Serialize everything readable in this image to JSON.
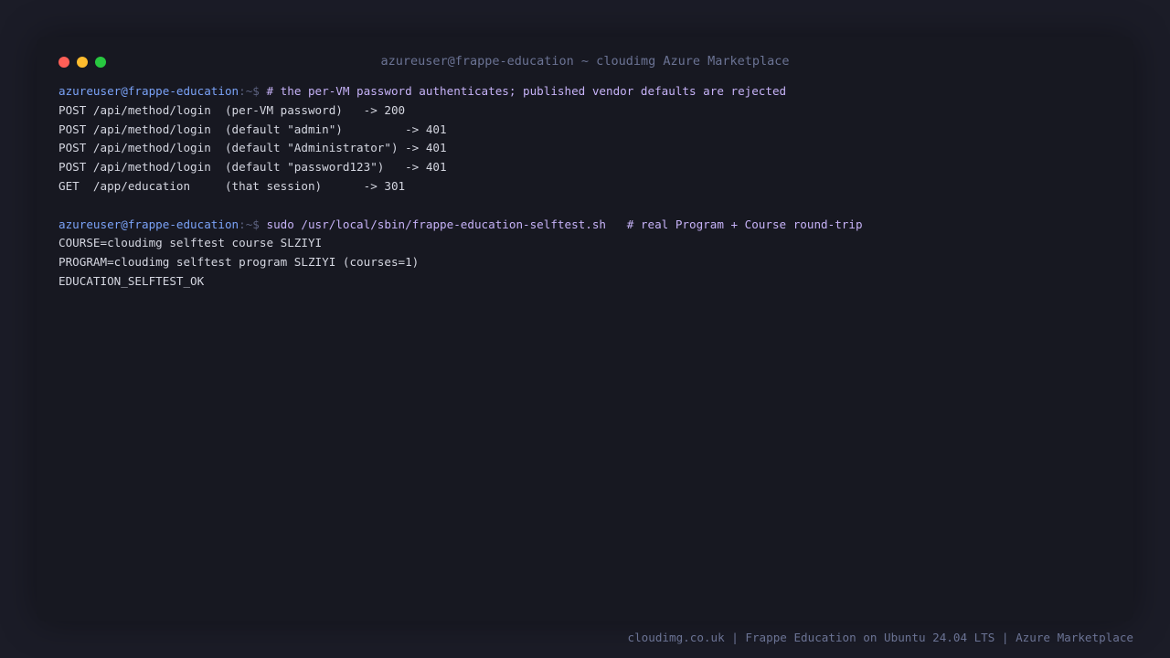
{
  "window": {
    "title": "azureuser@frappe-education ~ cloudimg Azure Marketplace"
  },
  "terminal": {
    "block1": {
      "prompt_user": "azureuser@frappe-education",
      "prompt_sep": ":~$ ",
      "command": "# the per-VM password authenticates; published vendor defaults are rejected",
      "output": [
        "POST /api/method/login  (per-VM password)   -> 200",
        "POST /api/method/login  (default \"admin\")         -> 401",
        "POST /api/method/login  (default \"Administrator\") -> 401",
        "POST /api/method/login  (default \"password123\")   -> 401",
        "GET  /app/education     (that session)      -> 301"
      ]
    },
    "block2": {
      "prompt_user": "azureuser@frappe-education",
      "prompt_sep": ":~$ ",
      "command": "sudo /usr/local/sbin/frappe-education-selftest.sh   # real Program + Course round-trip",
      "output": [
        "COURSE=cloudimg selftest course SLZIYI",
        "PROGRAM=cloudimg selftest program SLZIYI (courses=1)",
        "EDUCATION_SELFTEST_OK"
      ]
    }
  },
  "footer": {
    "text": "cloudimg.co.uk | Frappe Education on Ubuntu 24.04 LTS | Azure Marketplace"
  },
  "colors": {
    "background": "#1b1c27",
    "window": "#171821",
    "prompt_user": "#7aa2f7",
    "command": "#c6b2f7",
    "output": "#d4d6e0",
    "muted": "#6b7394"
  }
}
